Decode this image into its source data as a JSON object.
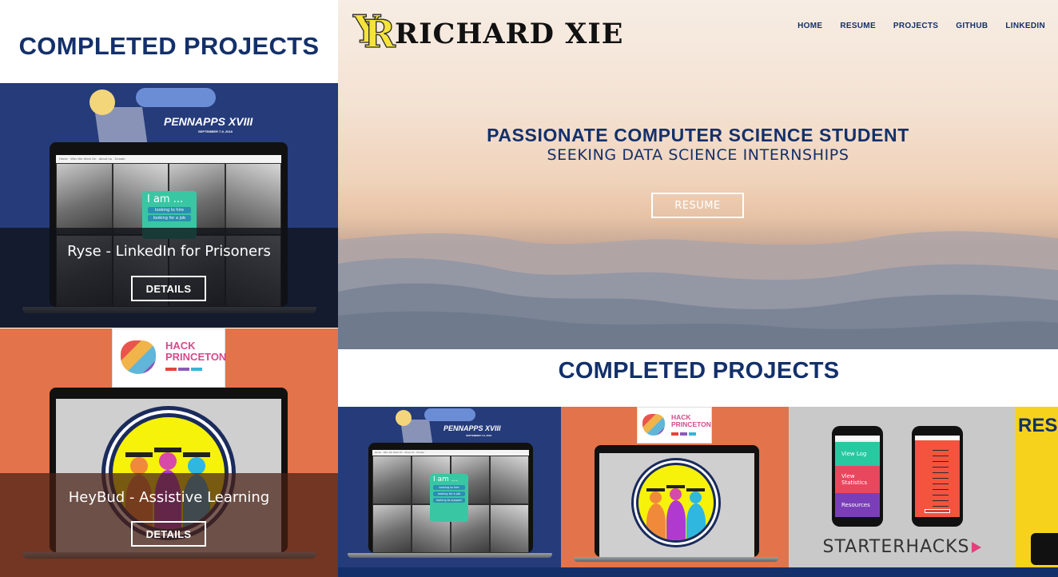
{
  "mobile": {
    "section_title": "COMPLETED PROJECTS",
    "projects": [
      {
        "title": "Ryse - LinkedIn for Prisoners",
        "button": "DETAILS",
        "hackathon": "PENNAPPS XVIII",
        "hackathon_date": "SEPTEMBER 7-9, 2018"
      },
      {
        "title": "HeyBud - Assistive Learning",
        "button": "DETAILS",
        "hackathon": "HACK PRINCETON"
      }
    ]
  },
  "desktop": {
    "brand": {
      "monogram_y": "Y",
      "monogram_r": "R",
      "name": "RICHARD XIE"
    },
    "nav": [
      "HOME",
      "RESUME",
      "PROJECTS",
      "GITHUB",
      "LINKEDIN"
    ],
    "hero": {
      "headline": "PASSIONATE COMPUTER SCIENCE STUDENT",
      "subheadline": "SEEKING DATA SCIENCE INTERNSHIPS",
      "button": "RESUME"
    },
    "section_title": "COMPLETED PROJECTS",
    "tiles": {
      "pennapps": "PENNAPPS XVIII",
      "pennapps_date": "SEPTEMBER 7-9, 2018",
      "hackprinceton": "HACK PRINCETON",
      "starterhacks": "STARTERHACKS",
      "partial": "RES",
      "phone_menu": [
        "View Log",
        "View Statistics",
        "Resources"
      ]
    },
    "laptop_screen": {
      "iam": "I am ...",
      "options": [
        "looking to hire",
        "looking for a job",
        "looking to support"
      ],
      "nav": [
        "Home",
        "Who We Work On",
        "About Us",
        "Donate"
      ]
    }
  },
  "colors": {
    "navy": "#13306b",
    "pennapps_blue": "#253b7a",
    "hackprinceton_orange": "#e2734a",
    "starterhacks_grey": "#c9c9c9",
    "resume_yellow": "#f6d21c",
    "accent_green": "#39c7a3"
  }
}
